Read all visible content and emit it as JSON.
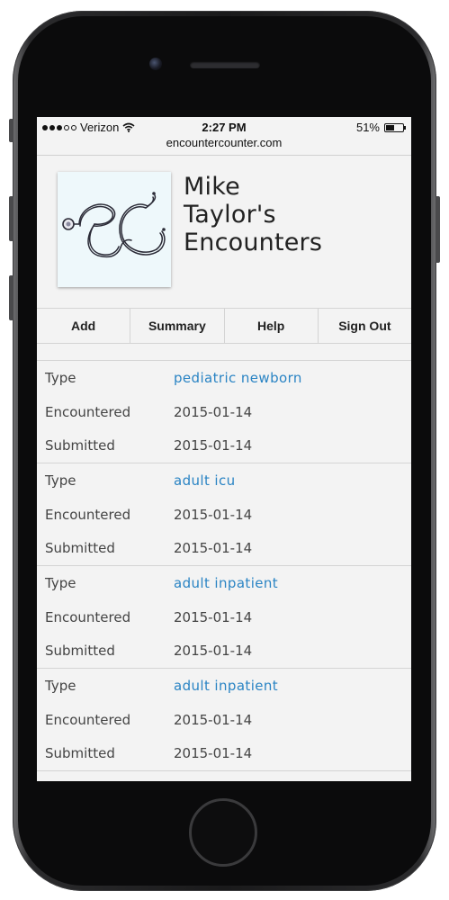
{
  "status_bar": {
    "carrier": "Verizon",
    "time": "2:27 PM",
    "battery_percent": "51%",
    "battery_level": 0.51,
    "signal_bars": 3,
    "icons": [
      "signal-dots-icon",
      "wifi-icon",
      "battery-icon"
    ]
  },
  "browser": {
    "url": "encountercounter.com"
  },
  "header": {
    "title_line1": "Mike",
    "title_line2": "Taylor's",
    "title_line3": "Encounters",
    "logo_icon": "stethoscope-icon"
  },
  "nav": {
    "add": "Add",
    "summary": "Summary",
    "help": "Help",
    "sign_out": "Sign Out"
  },
  "labels": {
    "type": "Type",
    "encountered": "Encountered",
    "submitted": "Submitted"
  },
  "encounters": [
    {
      "type": "pediatric newborn",
      "encountered": "2015-01-14",
      "submitted": "2015-01-14"
    },
    {
      "type": "adult icu",
      "encountered": "2015-01-14",
      "submitted": "2015-01-14"
    },
    {
      "type": "adult inpatient",
      "encountered": "2015-01-14",
      "submitted": "2015-01-14"
    },
    {
      "type": "adult inpatient",
      "encountered": "2015-01-14",
      "submitted": "2015-01-14"
    }
  ],
  "colors": {
    "link": "#2a84c4",
    "background": "#f3f3f3",
    "logo_background": "#eef8fb"
  }
}
